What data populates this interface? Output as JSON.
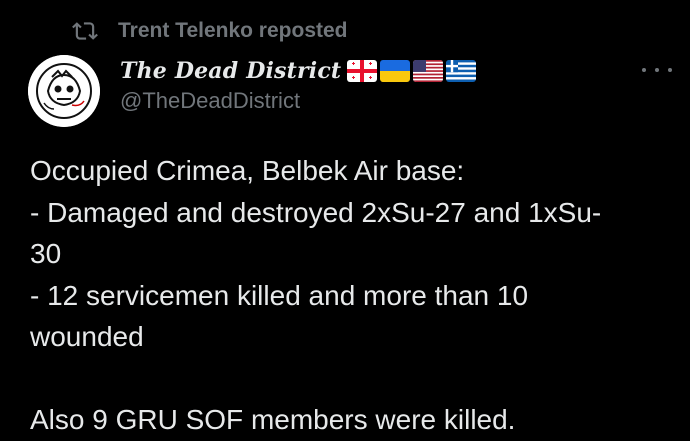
{
  "repost": {
    "icon": "repost-icon",
    "label": "Trent Telenko reposted"
  },
  "author": {
    "display_name": "The Dead District",
    "handle": "@TheDeadDistrict",
    "avatar_icon": "avatar-logo",
    "flags": [
      "georgia-flag",
      "ukraine-flag",
      "usa-flag",
      "greece-flag"
    ]
  },
  "menu": {
    "icon": "more-icon"
  },
  "tweet": {
    "lines": [
      "Occupied Crimea, Belbek Air base:",
      "- Damaged and destroyed 2xSu-27 and 1xSu-",
      "30",
      "- 12 servicemen killed and more than 10",
      "wounded",
      "",
      "Also 9 GRU SOF members were killed."
    ]
  },
  "colors": {
    "background": "#000000",
    "text": "#e7e9ea",
    "muted": "#71767b"
  }
}
